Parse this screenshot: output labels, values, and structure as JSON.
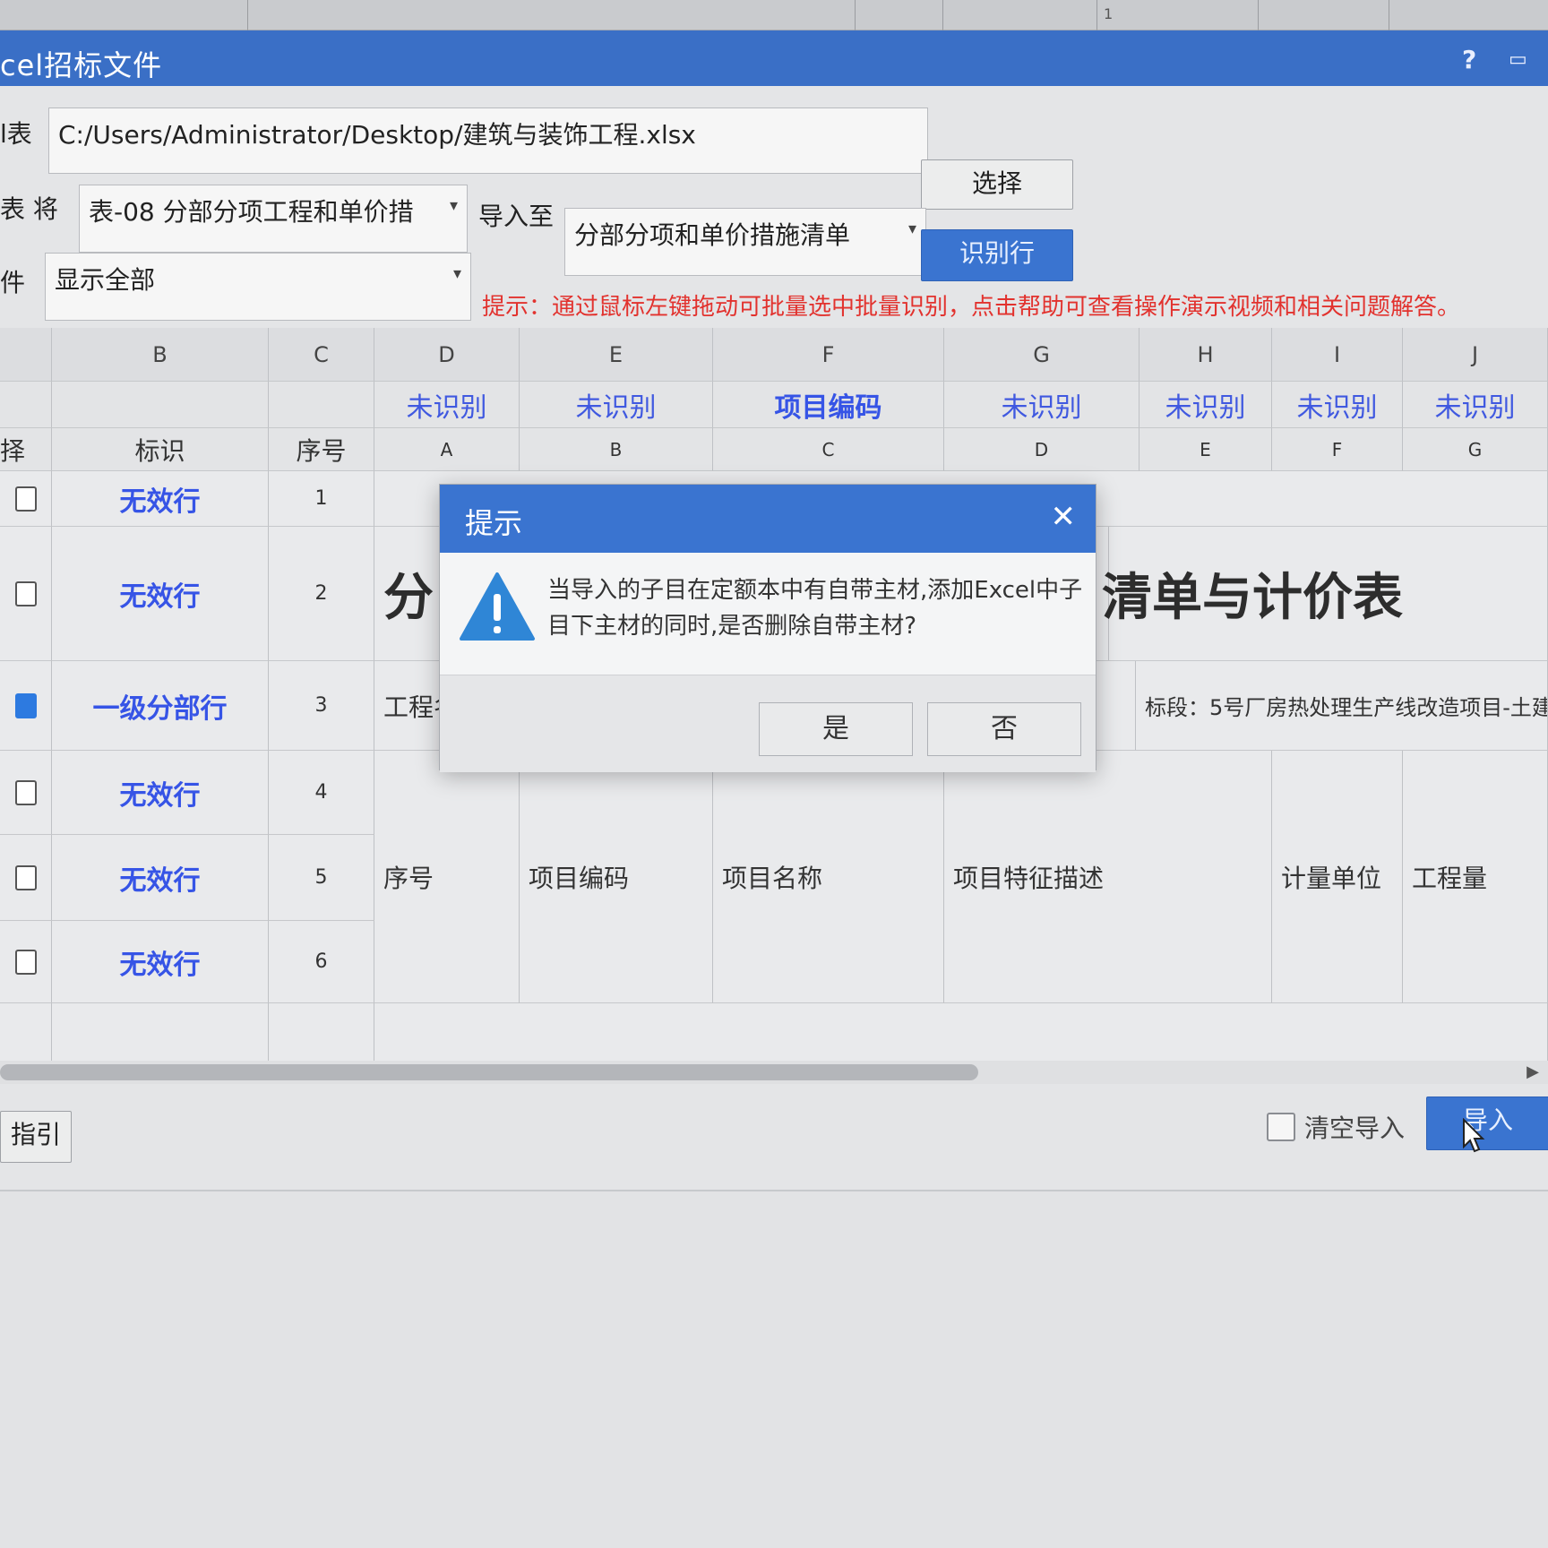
{
  "window": {
    "title": "cel招标文件",
    "help_icon": "question-icon",
    "restore_icon": "restore-icon"
  },
  "background": {
    "row_number": "1"
  },
  "form": {
    "sheet_label": "l表",
    "file_path": "C:/Users/Administrator/Desktop/建筑与装饰工程.xlsx",
    "choose_button": "选择",
    "table_label": "表 将",
    "table_select": "表-08 分部分项工程和单价措",
    "import_to_label": "导入至",
    "import_to_select": "分部分项和单价措施清单",
    "identify_button": "识别行",
    "filter_label": "件",
    "filter_select": "显示全部",
    "hint": "提示：通过鼠标左键拖动可批量选中批量识别，点击帮助可查看操作演示视频和相关问题解答。"
  },
  "grid": {
    "col_letters": [
      "B",
      "C",
      "D",
      "E",
      "F",
      "G",
      "H",
      "I",
      "J"
    ],
    "col_types": [
      "未识别",
      "未识别",
      "项目编码",
      "未识别",
      "未识别",
      "未识别",
      "未识别"
    ],
    "head_select": "择",
    "head_mark": "标识",
    "head_seq": "序号",
    "src_cols": [
      "A",
      "B",
      "C",
      "D",
      "E",
      "F",
      "G"
    ],
    "rows": [
      {
        "mark": "无效行",
        "seq": "1"
      },
      {
        "mark": "无效行",
        "seq": "2"
      },
      {
        "mark": "一级分部行",
        "seq": "3"
      },
      {
        "mark": "无效行",
        "seq": "4"
      },
      {
        "mark": "无效行",
        "seq": "5"
      },
      {
        "mark": "无效行",
        "seq": "6"
      }
    ],
    "row2_big_left": "分",
    "row2_big_right": "清单与计价表",
    "row3_left": "工程名",
    "row3_right": "标段：5号厂房热处理生产线改造项目-土建",
    "row5_cells": [
      "序号",
      "项目编码",
      "项目名称",
      "项目特征描述",
      "计量单位",
      "工程量"
    ]
  },
  "bottom": {
    "guide_button": "指引",
    "clear_import_label": "清空导入",
    "import_button": "导入"
  },
  "dialog": {
    "title": "提示",
    "message": "当导入的子目在定额本中有自带主材,添加Excel中子目下主材的同时,是否删除自带主材?",
    "yes": "是",
    "no": "否"
  }
}
